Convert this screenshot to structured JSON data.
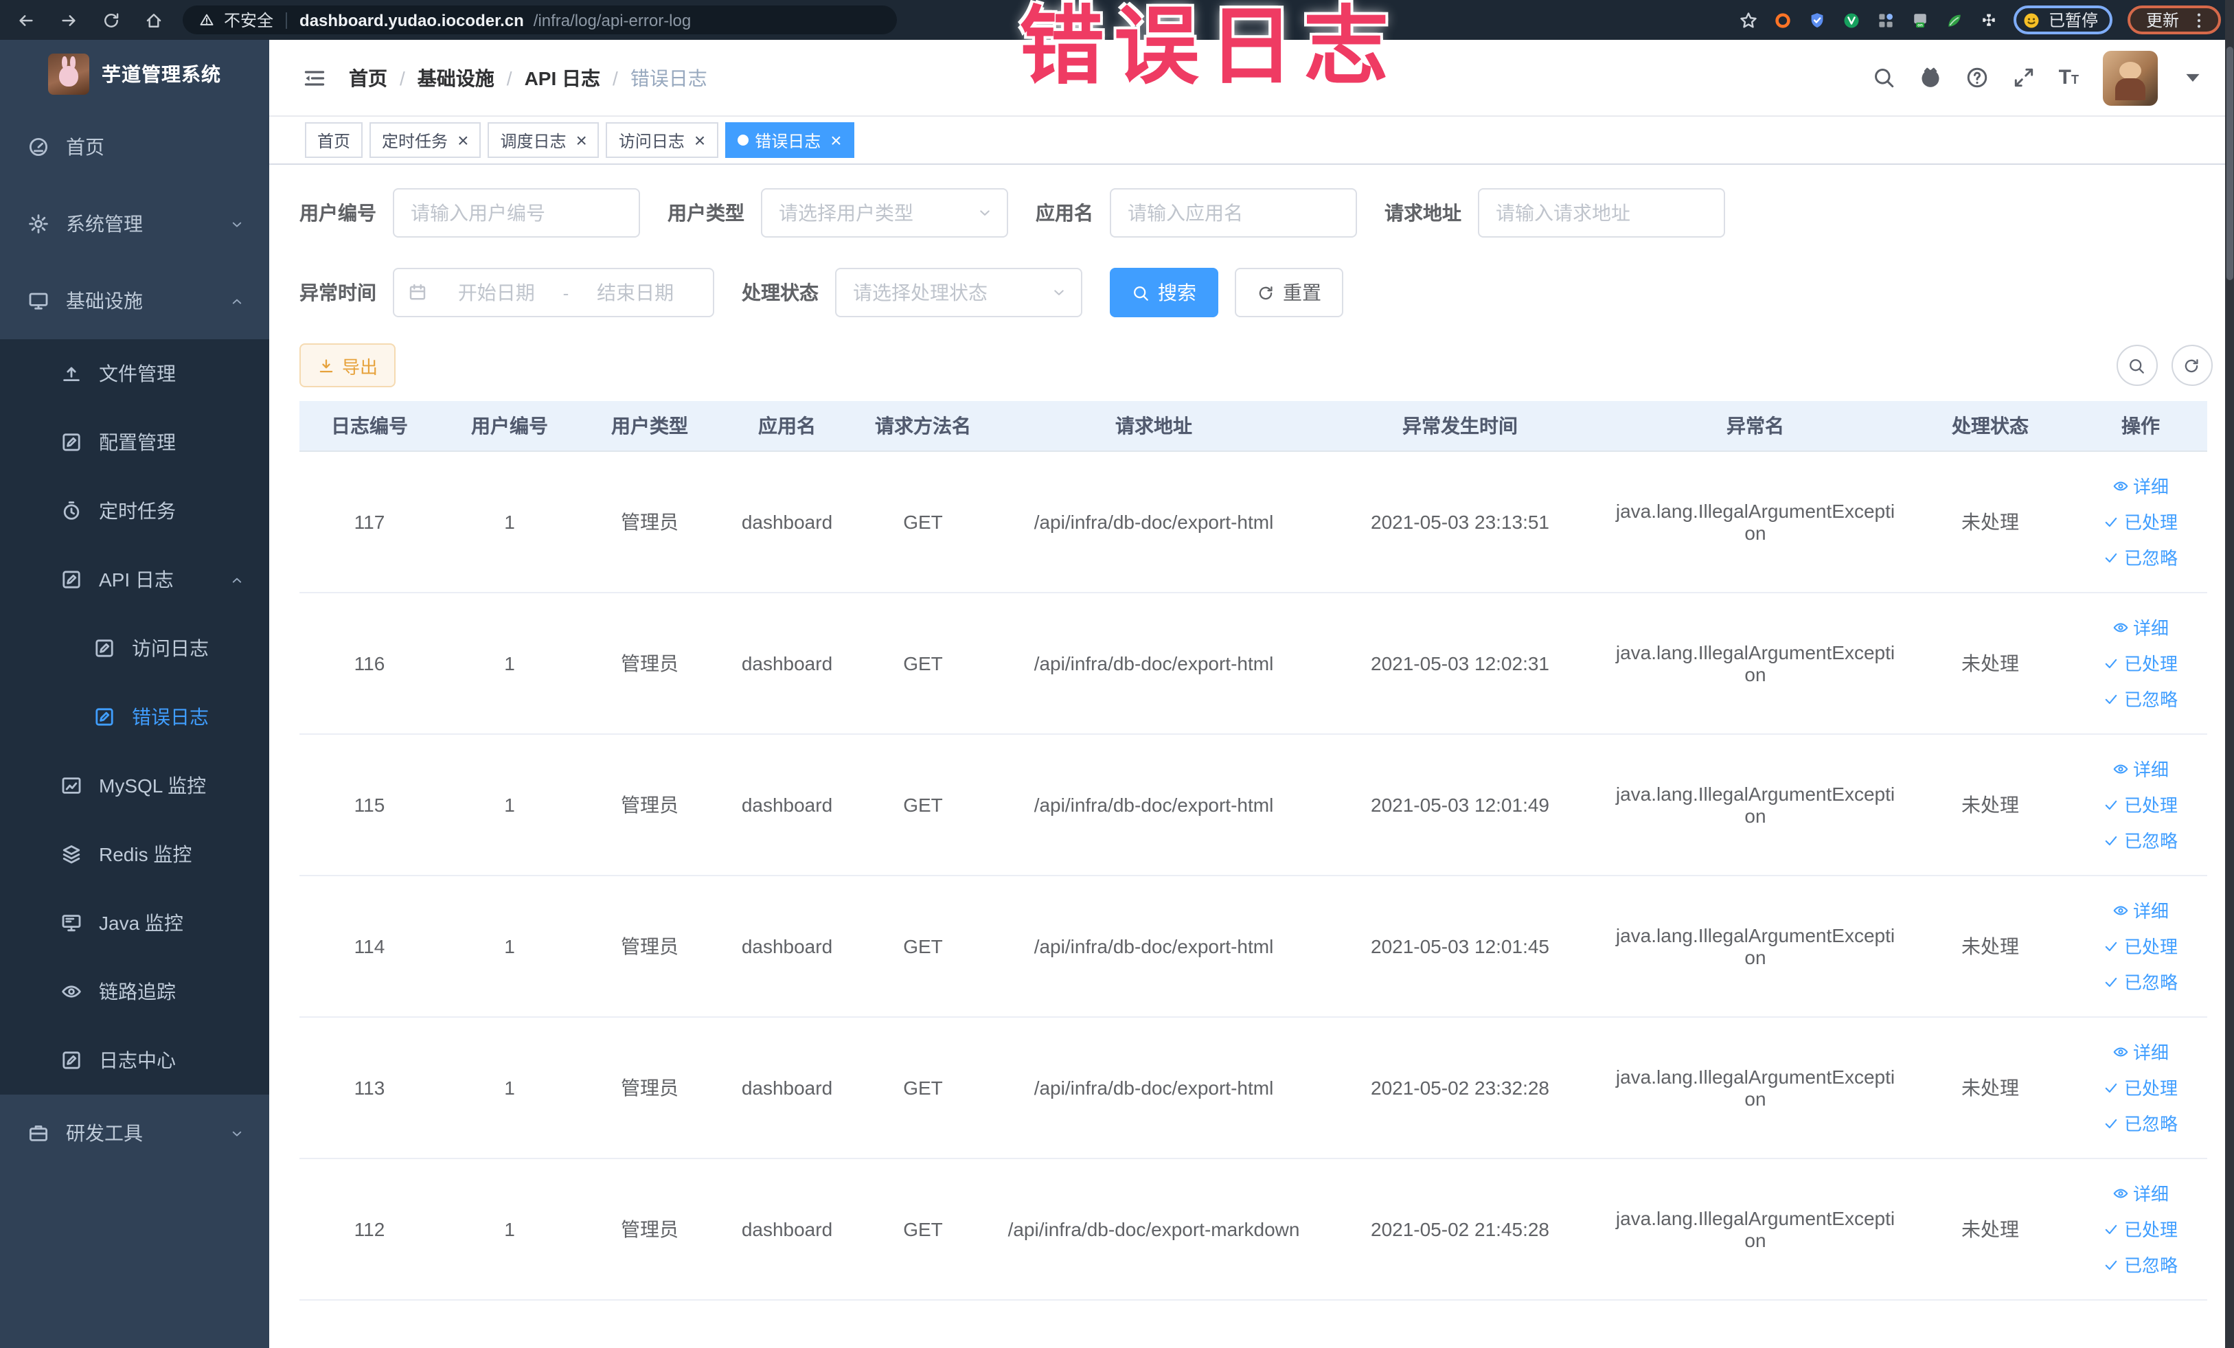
{
  "colors": {
    "accent": "#409eff",
    "annotation_red": "#ef3b63",
    "warning_orange": "#e6a23c",
    "sidebar_bg": "#304156",
    "submenu_bg": "#1f2d3d",
    "table_header_bg": "#eaf2fb"
  },
  "browser": {
    "security_label": "不安全",
    "url_host": "dashboard.yudao.iocoder.cn",
    "url_path": "/infra/log/api-error-log",
    "paused_badge": "已暂停",
    "update_label": "更新",
    "nav_icons": [
      "back",
      "forward",
      "reload",
      "home"
    ],
    "extension_icons": [
      "orange-ring",
      "shield",
      "green-check",
      "grid",
      "on-badge",
      "leaf",
      "puzzle"
    ]
  },
  "annotation": {
    "text": "错误日志"
  },
  "sidebar": {
    "title": "芋道管理系统",
    "items": [
      {
        "label": "首页",
        "icon": "gauge",
        "level": 1
      },
      {
        "label": "系统管理",
        "icon": "gear",
        "level": 1,
        "arrow": "down"
      },
      {
        "label": "基础设施",
        "icon": "monitor",
        "level": 1,
        "arrow": "up"
      },
      {
        "label": "文件管理",
        "icon": "upload",
        "level": 2,
        "group": true
      },
      {
        "label": "配置管理",
        "icon": "edit",
        "level": 2,
        "group": true
      },
      {
        "label": "定时任务",
        "icon": "timer",
        "level": 2,
        "group": true
      },
      {
        "label": "API 日志",
        "icon": "edit",
        "level": 2,
        "group": true,
        "arrow": "up"
      },
      {
        "label": "访问日志",
        "icon": "edit",
        "level": 3,
        "group": true
      },
      {
        "label": "错误日志",
        "icon": "edit",
        "level": 3,
        "group": true,
        "active": true
      },
      {
        "label": "MySQL 监控",
        "icon": "chart",
        "level": 2,
        "group": true
      },
      {
        "label": "Redis 监控",
        "icon": "layers",
        "level": 2,
        "group": true
      },
      {
        "label": "Java 监控",
        "icon": "screen",
        "level": 2,
        "group": true
      },
      {
        "label": "链路追踪",
        "icon": "eye",
        "level": 2,
        "group": true
      },
      {
        "label": "日志中心",
        "icon": "edit",
        "level": 2,
        "group": true
      },
      {
        "label": "研发工具",
        "icon": "briefcase",
        "level": 1,
        "arrow": "down"
      }
    ]
  },
  "header": {
    "breadcrumb": [
      "首页",
      "基础设施",
      "API 日志",
      "错误日志"
    ],
    "right_icons": [
      "search",
      "github",
      "question",
      "fullscreen",
      "font-size",
      "avatar",
      "caret-down"
    ]
  },
  "tabs": [
    {
      "label": "首页",
      "closable": false,
      "active": false
    },
    {
      "label": "定时任务",
      "closable": true,
      "active": false
    },
    {
      "label": "调度日志",
      "closable": true,
      "active": false
    },
    {
      "label": "访问日志",
      "closable": true,
      "active": false
    },
    {
      "label": "错误日志",
      "closable": true,
      "active": true
    }
  ],
  "filters": {
    "user_id": {
      "label": "用户编号",
      "placeholder": "请输入用户编号"
    },
    "user_type": {
      "label": "用户类型",
      "placeholder": "请选择用户类型"
    },
    "app_name": {
      "label": "应用名",
      "placeholder": "请输入应用名"
    },
    "request_url": {
      "label": "请求地址",
      "placeholder": "请输入请求地址"
    },
    "exception_time": {
      "label": "异常时间",
      "start_placeholder": "开始日期",
      "separator": "-",
      "end_placeholder": "结束日期"
    },
    "process_status": {
      "label": "处理状态",
      "placeholder": "请选择处理状态"
    },
    "search_button": "搜索",
    "reset_button": "重置"
  },
  "toolbar": {
    "export_label": "导出",
    "circle_icons": [
      "search",
      "refresh"
    ]
  },
  "table": {
    "columns": [
      "日志编号",
      "用户编号",
      "用户类型",
      "应用名",
      "请求方法名",
      "请求地址",
      "异常发生时间",
      "异常名",
      "处理状态",
      "操作"
    ],
    "row_actions": [
      {
        "name": "detail",
        "label": "详细",
        "icon": "eye"
      },
      {
        "name": "processed",
        "label": "已处理",
        "icon": "check"
      },
      {
        "name": "ignored",
        "label": "已忽略",
        "icon": "check"
      }
    ],
    "rows": [
      {
        "id": "117",
        "user_id": "1",
        "user_type": "管理员",
        "app": "dashboard",
        "method": "GET",
        "url": "/api/infra/db-doc/export-html",
        "time": "2021-05-03 23:13:51",
        "exception": "java.lang.IllegalArgumentException",
        "status": "未处理"
      },
      {
        "id": "116",
        "user_id": "1",
        "user_type": "管理员",
        "app": "dashboard",
        "method": "GET",
        "url": "/api/infra/db-doc/export-html",
        "time": "2021-05-03 12:02:31",
        "exception": "java.lang.IllegalArgumentException",
        "status": "未处理"
      },
      {
        "id": "115",
        "user_id": "1",
        "user_type": "管理员",
        "app": "dashboard",
        "method": "GET",
        "url": "/api/infra/db-doc/export-html",
        "time": "2021-05-03 12:01:49",
        "exception": "java.lang.IllegalArgumentException",
        "status": "未处理"
      },
      {
        "id": "114",
        "user_id": "1",
        "user_type": "管理员",
        "app": "dashboard",
        "method": "GET",
        "url": "/api/infra/db-doc/export-html",
        "time": "2021-05-03 12:01:45",
        "exception": "java.lang.IllegalArgumentException",
        "status": "未处理"
      },
      {
        "id": "113",
        "user_id": "1",
        "user_type": "管理员",
        "app": "dashboard",
        "method": "GET",
        "url": "/api/infra/db-doc/export-html",
        "time": "2021-05-02 23:32:28",
        "exception": "java.lang.IllegalArgumentException",
        "status": "未处理"
      },
      {
        "id": "112",
        "user_id": "1",
        "user_type": "管理员",
        "app": "dashboard",
        "method": "GET",
        "url": "/api/infra/db-doc/export-markdown",
        "time": "2021-05-02 21:45:28",
        "exception": "java.lang.IllegalArgumentException",
        "status": "未处理"
      }
    ]
  }
}
